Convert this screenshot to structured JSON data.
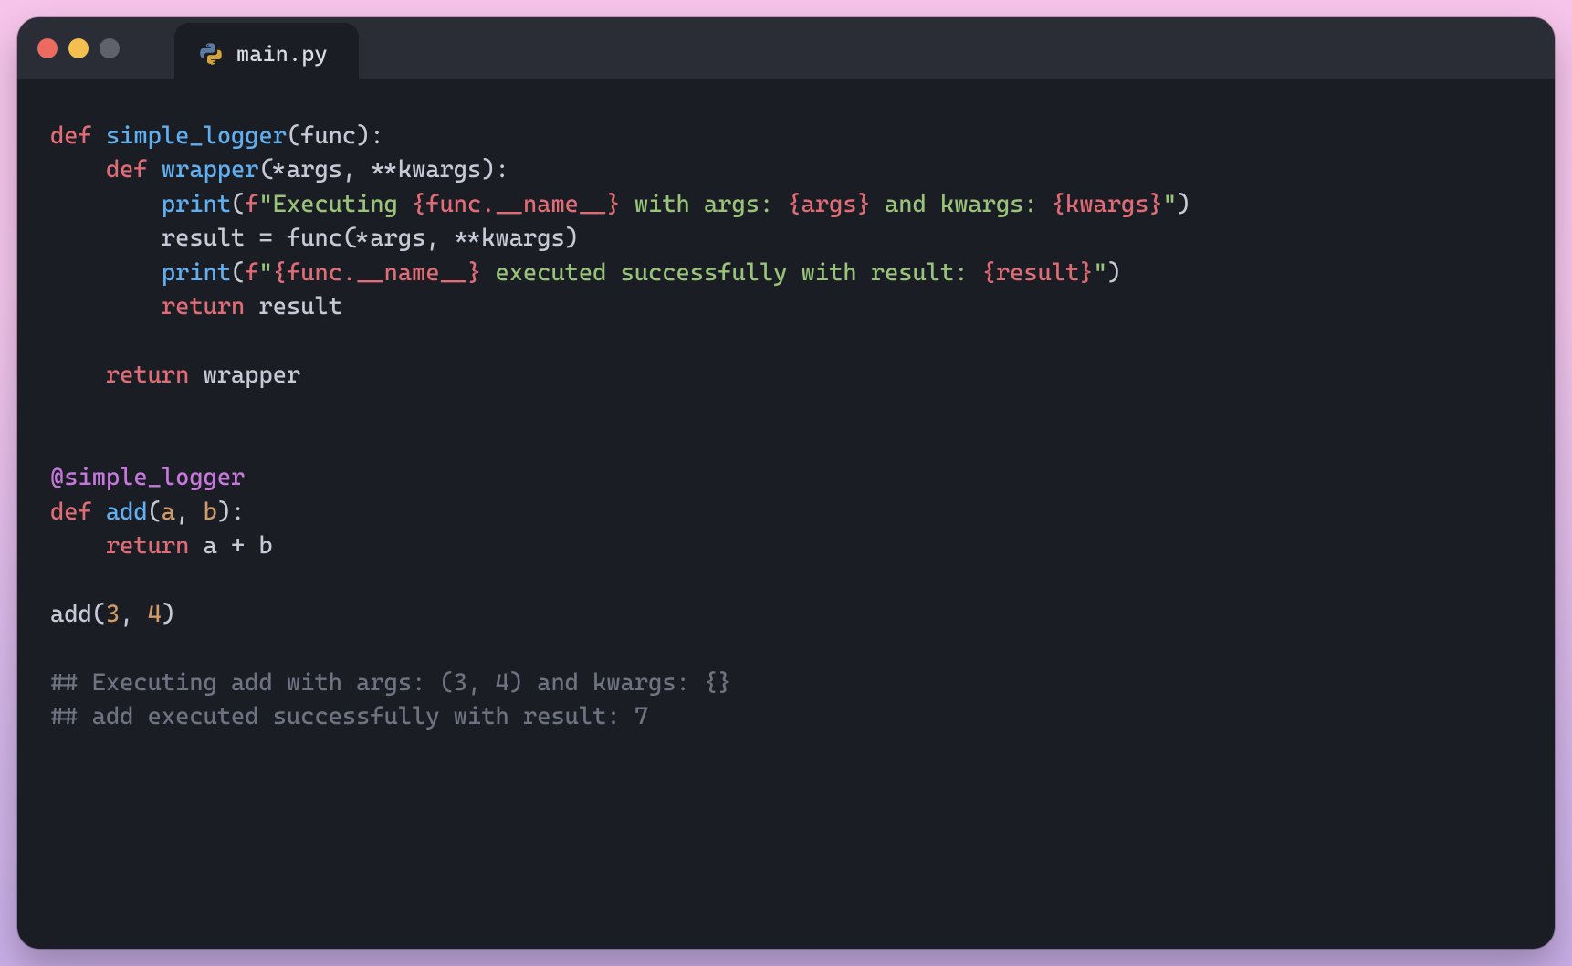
{
  "tab": {
    "filename": "main.py",
    "icon": "python-icon"
  },
  "window_controls": {
    "close": "red",
    "minimize": "yellow",
    "maximize_disabled": "grey"
  },
  "code": {
    "lines": [
      [
        {
          "t": "kw",
          "v": "def"
        },
        {
          "t": "sp",
          "v": " "
        },
        {
          "t": "fn",
          "v": "simple_logger"
        },
        {
          "t": "punct",
          "v": "("
        },
        {
          "t": "ident",
          "v": "func"
        },
        {
          "t": "punct",
          "v": "):"
        }
      ],
      [
        {
          "t": "indent",
          "v": "    "
        },
        {
          "t": "kw",
          "v": "def"
        },
        {
          "t": "sp",
          "v": " "
        },
        {
          "t": "fn",
          "v": "wrapper"
        },
        {
          "t": "punct",
          "v": "("
        },
        {
          "t": "op",
          "v": "*"
        },
        {
          "t": "ident",
          "v": "args"
        },
        {
          "t": "punct",
          "v": ", "
        },
        {
          "t": "op",
          "v": "**"
        },
        {
          "t": "ident",
          "v": "kwargs"
        },
        {
          "t": "punct",
          "v": "):"
        }
      ],
      [
        {
          "t": "indent",
          "v": "        "
        },
        {
          "t": "builtin",
          "v": "print"
        },
        {
          "t": "punct",
          "v": "("
        },
        {
          "t": "fprefix",
          "v": "f"
        },
        {
          "t": "str",
          "v": "\"Executing "
        },
        {
          "t": "interp",
          "v": "{func.__name__}"
        },
        {
          "t": "str",
          "v": " with args: "
        },
        {
          "t": "interp",
          "v": "{args}"
        },
        {
          "t": "str",
          "v": " and kwargs: "
        },
        {
          "t": "interp",
          "v": "{kwargs}"
        },
        {
          "t": "str",
          "v": "\""
        },
        {
          "t": "punct",
          "v": ")"
        }
      ],
      [
        {
          "t": "indent",
          "v": "        "
        },
        {
          "t": "ident",
          "v": "result"
        },
        {
          "t": "sp",
          "v": " "
        },
        {
          "t": "op",
          "v": "="
        },
        {
          "t": "sp",
          "v": " "
        },
        {
          "t": "ident",
          "v": "func"
        },
        {
          "t": "punct",
          "v": "("
        },
        {
          "t": "op",
          "v": "*"
        },
        {
          "t": "ident",
          "v": "args"
        },
        {
          "t": "punct",
          "v": ", "
        },
        {
          "t": "op",
          "v": "**"
        },
        {
          "t": "ident",
          "v": "kwargs"
        },
        {
          "t": "punct",
          "v": ")"
        }
      ],
      [
        {
          "t": "indent",
          "v": "        "
        },
        {
          "t": "builtin",
          "v": "print"
        },
        {
          "t": "punct",
          "v": "("
        },
        {
          "t": "fprefix",
          "v": "f"
        },
        {
          "t": "str",
          "v": "\""
        },
        {
          "t": "interp",
          "v": "{func.__name__}"
        },
        {
          "t": "str",
          "v": " executed successfully with result: "
        },
        {
          "t": "interp",
          "v": "{result}"
        },
        {
          "t": "str",
          "v": "\""
        },
        {
          "t": "punct",
          "v": ")"
        }
      ],
      [
        {
          "t": "indent",
          "v": "        "
        },
        {
          "t": "kw",
          "v": "return"
        },
        {
          "t": "sp",
          "v": " "
        },
        {
          "t": "ident",
          "v": "result"
        }
      ],
      [
        {
          "t": "blank",
          "v": ""
        }
      ],
      [
        {
          "t": "indent",
          "v": "    "
        },
        {
          "t": "kw",
          "v": "return"
        },
        {
          "t": "sp",
          "v": " "
        },
        {
          "t": "ident",
          "v": "wrapper"
        }
      ],
      [
        {
          "t": "blank",
          "v": ""
        }
      ],
      [
        {
          "t": "blank",
          "v": ""
        }
      ],
      [
        {
          "t": "deco",
          "v": "@simple_logger"
        }
      ],
      [
        {
          "t": "kw",
          "v": "def"
        },
        {
          "t": "sp",
          "v": " "
        },
        {
          "t": "fn",
          "v": "add"
        },
        {
          "t": "punct",
          "v": "("
        },
        {
          "t": "param",
          "v": "a"
        },
        {
          "t": "punct",
          "v": ", "
        },
        {
          "t": "param",
          "v": "b"
        },
        {
          "t": "punct",
          "v": "):"
        }
      ],
      [
        {
          "t": "indent",
          "v": "    "
        },
        {
          "t": "kw",
          "v": "return"
        },
        {
          "t": "sp",
          "v": " "
        },
        {
          "t": "ident",
          "v": "a"
        },
        {
          "t": "sp",
          "v": " "
        },
        {
          "t": "op",
          "v": "+"
        },
        {
          "t": "sp",
          "v": " "
        },
        {
          "t": "ident",
          "v": "b"
        }
      ],
      [
        {
          "t": "blank",
          "v": ""
        }
      ],
      [
        {
          "t": "ident",
          "v": "add"
        },
        {
          "t": "punct",
          "v": "("
        },
        {
          "t": "num",
          "v": "3"
        },
        {
          "t": "punct",
          "v": ", "
        },
        {
          "t": "num",
          "v": "4"
        },
        {
          "t": "punct",
          "v": ")"
        }
      ],
      [
        {
          "t": "blank",
          "v": ""
        }
      ],
      [
        {
          "t": "comment",
          "v": "## Executing add with args: (3, 4) and kwargs: {}"
        }
      ],
      [
        {
          "t": "comment",
          "v": "## add executed successfully with result: 7"
        }
      ]
    ]
  }
}
